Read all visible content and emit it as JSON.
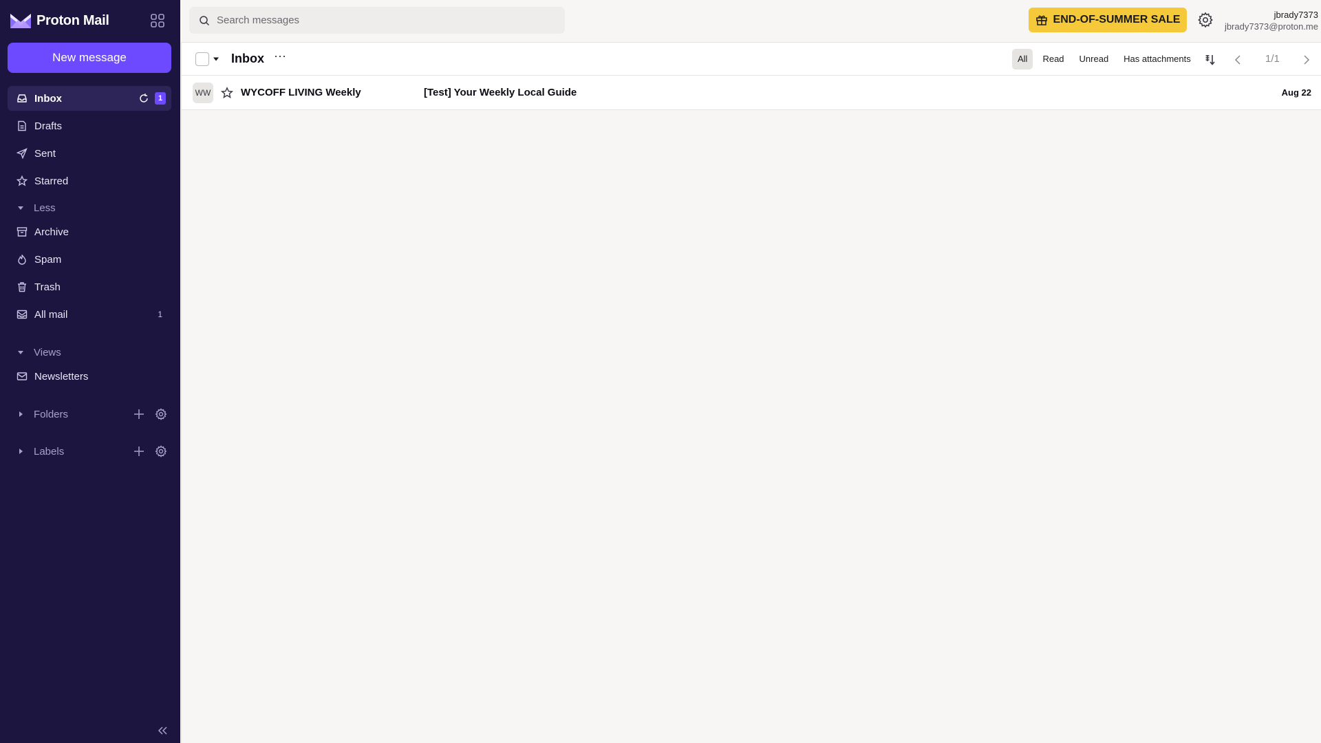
{
  "app": {
    "brand": "Proton Mail",
    "colors": {
      "sidebar": "#1c1540",
      "accent": "#6d4aff",
      "sale": "#f5c93a",
      "background": "#f7f6f4"
    }
  },
  "sidebar": {
    "new_message_label": "New message",
    "items": [
      {
        "label": "Inbox",
        "icon": "inbox-icon",
        "badge": "1",
        "active": true
      },
      {
        "label": "Drafts",
        "icon": "drafts-icon"
      },
      {
        "label": "Sent",
        "icon": "sent-icon"
      },
      {
        "label": "Starred",
        "icon": "star-icon"
      },
      {
        "label": "Archive",
        "icon": "archive-icon"
      },
      {
        "label": "Spam",
        "icon": "spam-icon"
      },
      {
        "label": "Trash",
        "icon": "trash-icon"
      },
      {
        "label": "All mail",
        "icon": "all-mail-icon",
        "count": "1"
      },
      {
        "label": "Newsletters",
        "icon": "newsletter-icon"
      }
    ],
    "less_label": "Less",
    "views_label": "Views",
    "folders_label": "Folders",
    "labels_label": "Labels"
  },
  "header": {
    "search_placeholder": "Search messages",
    "sale_label": "END-OF-SUMMER SALE",
    "user_name": "jbrady7373",
    "user_email": "jbrady7373@proton.me"
  },
  "toolbar": {
    "folder_title": "Inbox",
    "more_label": "⋯",
    "filters": [
      "All",
      "Read",
      "Unread",
      "Has attachments"
    ],
    "active_filter": "All",
    "page_indicator": "1/1"
  },
  "messages": [
    {
      "initials": "WW",
      "sender": "WYCOFF LIVING Weekly",
      "subject": "[Test] Your Weekly Local Guide",
      "date": "Aug 22"
    }
  ]
}
